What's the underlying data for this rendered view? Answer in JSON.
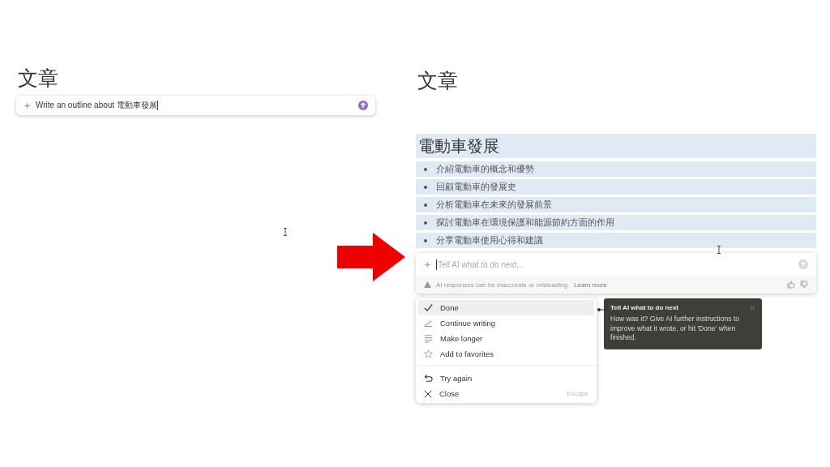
{
  "left": {
    "title": "文章",
    "prompt": {
      "value": "Write an outline about 電動車發展"
    }
  },
  "right": {
    "title": "文章",
    "heading": "電動車發展",
    "bullets": [
      "介紹電動車的概念和優勢",
      "回顧電動車的發展史",
      "分析電動車在未來的發展前景",
      "探討電動車在環境保護和能源節約方面的作用",
      "分享電動車使用心得和建議"
    ],
    "ai_box": {
      "placeholder": "Tell AI what to do next...",
      "warning": "AI responses can be inaccurate or misleading.",
      "link": "Learn more"
    },
    "menu": [
      [
        {
          "kind": "check",
          "label": "Done",
          "selected": true
        },
        {
          "kind": "pen",
          "label": "Continue writing",
          "selected": false
        },
        {
          "kind": "lines",
          "label": "Make longer",
          "selected": false
        },
        {
          "kind": "star",
          "label": "Add to favorites",
          "selected": false
        }
      ],
      [
        {
          "kind": "undo",
          "label": "Try again",
          "selected": false
        },
        {
          "kind": "close",
          "label": "Close",
          "shortcut": "Escape",
          "selected": false
        }
      ]
    ],
    "tooltip": {
      "title": "Tell AI what to do next",
      "body": "How was it? Give AI further instructions to improve what it wrote, or hit 'Done' when finished."
    }
  }
}
